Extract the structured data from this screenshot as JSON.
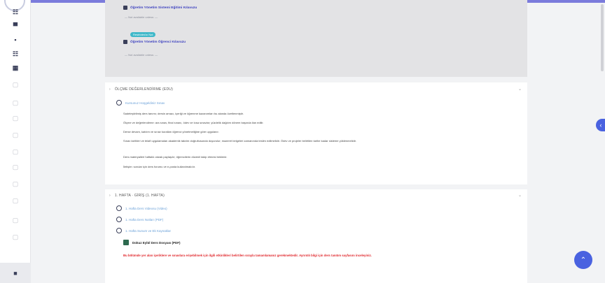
{
  "colors": {
    "accent": "#4a62e0",
    "topbar": "#7b7bdc",
    "link": "#3b3fbf",
    "warning": "#e0262b",
    "restricted_pill": "#3fb8c9"
  },
  "rail": {
    "icons": [
      {
        "name": "home-icon",
        "glyph": "☷"
      },
      {
        "name": "dashboard-icon",
        "glyph": "▀"
      },
      {
        "name": "calendar-icon",
        "glyph": "▪"
      },
      {
        "name": "files-icon",
        "glyph": "☷"
      },
      {
        "name": "courses-icon",
        "glyph": "▦"
      },
      {
        "name": "section-icon-1",
        "glyph": "▢"
      },
      {
        "name": "section-icon-2",
        "glyph": "▢"
      },
      {
        "name": "section-icon-3",
        "glyph": "▢"
      },
      {
        "name": "section-icon-4",
        "glyph": "▢"
      },
      {
        "name": "section-icon-5",
        "glyph": "▢"
      },
      {
        "name": "section-icon-6",
        "glyph": "▢"
      },
      {
        "name": "section-icon-7",
        "glyph": "▢"
      },
      {
        "name": "section-icon-8",
        "glyph": "▢"
      },
      {
        "name": "section-icon-9",
        "glyph": "▢"
      },
      {
        "name": "section-icon-10",
        "glyph": "▢"
      }
    ],
    "bottom_glyph": "■"
  },
  "top_block": {
    "activity_1": "Öğretim Yönetim Sistemi Eğitimi Kılavuzu",
    "restriction_1": "— Not available unless: —",
    "pill": "Restricted ▸ Not",
    "activity_2": "Öğretim Yönetim Öğrenci Kılavuzu",
    "restriction_2": "— Not available unless: —"
  },
  "section_1": {
    "title": "ÖLÇME DEĞERLENDİRME (EDU)",
    "link": "Kursunuz Hoşgeldiniz Sınav",
    "paragraphs": [
      "Sadeleştirilmiş ders tanımı; dersin amacı, içeriği ve öğrenme kazanımları bu alanda özetlenmiştir.",
      "Ölçme ve değerlendirme: ara sınav, final sınavı, ödev ve kısa sınavlar; yüzdelik dağılım dönem başında ilan edilir.",
      "Derse devam, katılım ve sınav kuralları öğrenci yönetmeliğine göre uygulanır.",
      "Sınav tarihleri ve telafi uygulamaları akademik takvim doğrultusunda duyurulur; mazeret belgeleri zamanında teslim edilmelidir. Ödev ve projeler belirtilen tarihe kadar sisteme yüklenmelidir.",
      "Ders materyalleri haftalık olarak paylaşılır; öğrencilerin düzenli takip etmesi beklenir.",
      "İletişim: sorular için ders forumu ve e-posta kullanılmalıdır."
    ]
  },
  "section_2": {
    "title": "1. HAFTA · GİRİŞ (1. HAFTA)",
    "links": [
      "1. Hafta Ders Videosu (Video)",
      "1. Hafta Ders Notları (PDF)",
      "1. Hafta Sunum ve Ek Kaynaklar"
    ],
    "certificate": "Dokuz Eylül Ders Dosyası (PDF)",
    "warning": "Bu bölümde yer alan içeriklere ve sınavlara erişebilmek için ilgili etkinlikleri belirtilen sırayla tamamlamanız gerekmektedir. Ayrıntılı bilgi için ders tanıtım sayfasını inceleyiniz."
  },
  "controls": {
    "drawer_glyph": "‹",
    "to_top_glyph": "⌃",
    "collapse_glyph": "⌄",
    "section_chev": "›"
  }
}
